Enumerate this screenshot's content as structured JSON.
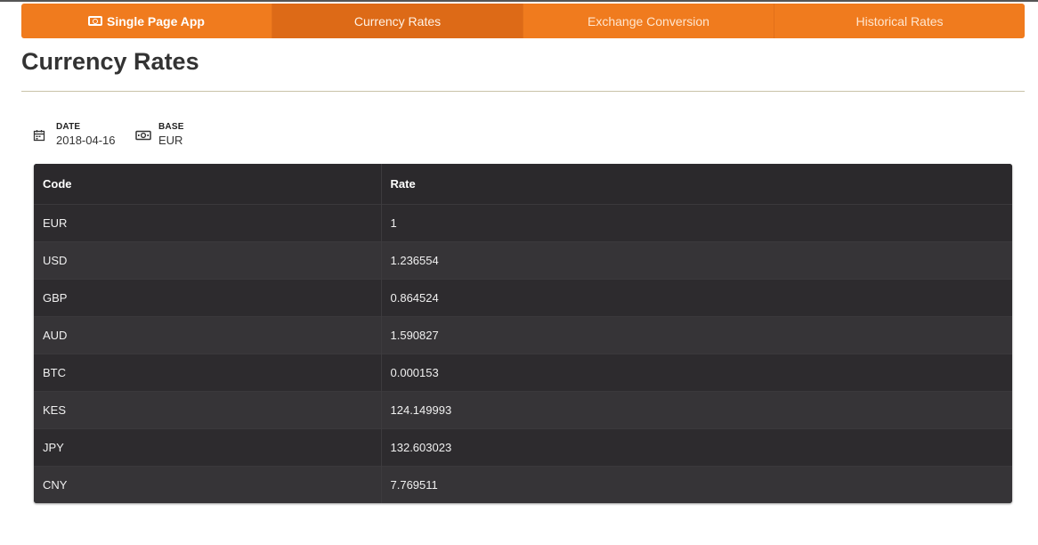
{
  "nav": {
    "brand": "Single Page App",
    "brand_icon": "money-icon",
    "items": [
      {
        "label": "Currency Rates",
        "active": true
      },
      {
        "label": "Exchange Conversion",
        "active": false
      },
      {
        "label": "Historical Rates",
        "active": false
      }
    ],
    "accent_color": "#f07b1e"
  },
  "page": {
    "title": "Currency Rates"
  },
  "meta": {
    "date_label": "DATE",
    "date_value": "2018-04-16",
    "date_icon": "calendar-icon",
    "base_label": "BASE",
    "base_value": "EUR",
    "base_icon": "money-icon"
  },
  "table": {
    "headers": [
      "Code",
      "Rate"
    ],
    "rows": [
      {
        "code": "EUR",
        "rate": "1"
      },
      {
        "code": "USD",
        "rate": "1.236554"
      },
      {
        "code": "GBP",
        "rate": "0.864524"
      },
      {
        "code": "AUD",
        "rate": "1.590827"
      },
      {
        "code": "BTC",
        "rate": "0.000153"
      },
      {
        "code": "KES",
        "rate": "124.149993"
      },
      {
        "code": "JPY",
        "rate": "132.603023"
      },
      {
        "code": "CNY",
        "rate": "7.769511"
      }
    ]
  }
}
